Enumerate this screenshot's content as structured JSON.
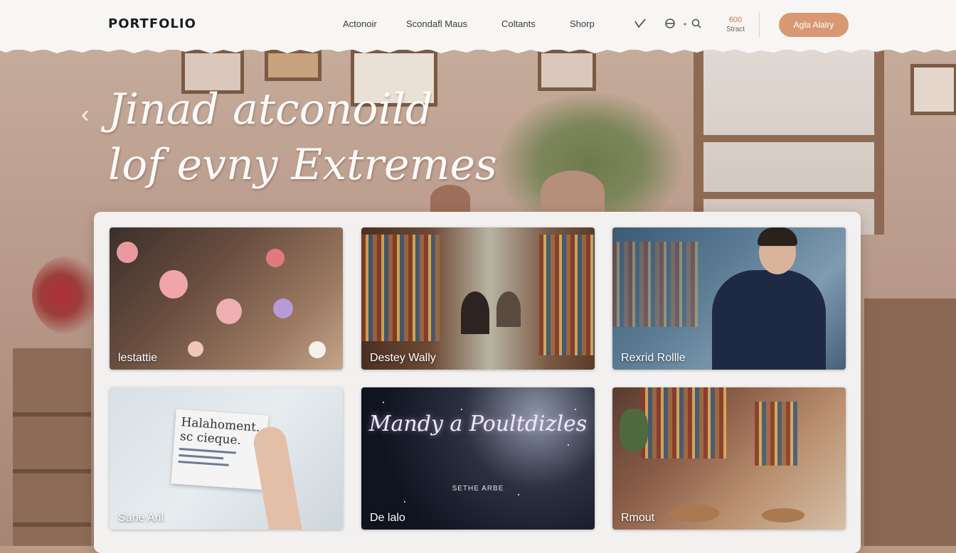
{
  "header": {
    "logo": "PORTFOLIO",
    "nav": [
      "Actonoir",
      "Scondafl Maus",
      "Coltants",
      "Shorp"
    ],
    "counter": {
      "value": "600",
      "label": "Stract"
    },
    "cta_label": "Agla Alalry",
    "icons": [
      "check-icon",
      "menu-icon",
      "dot-icon",
      "search-icon"
    ]
  },
  "hero": {
    "headline_line1": "Jinad atconoild",
    "headline_line2": "lof evny Extremes"
  },
  "gallery": {
    "items": [
      {
        "label": "lestattie"
      },
      {
        "label": "Destey Wally"
      },
      {
        "label": "Rexrid Rollle"
      },
      {
        "label": "Sane Aril",
        "note_text": "Halahoment.. sc cieque."
      },
      {
        "label": "De lalo",
        "title": "Mandy a Poultdizles",
        "subtitle": "SETHE ARBE"
      },
      {
        "label": "Rmout"
      }
    ]
  },
  "colors": {
    "accent": "#d89873",
    "counter": "#d0763f",
    "header_bg": "#f7f6f5",
    "panel_bg": "#f3f1f0"
  }
}
